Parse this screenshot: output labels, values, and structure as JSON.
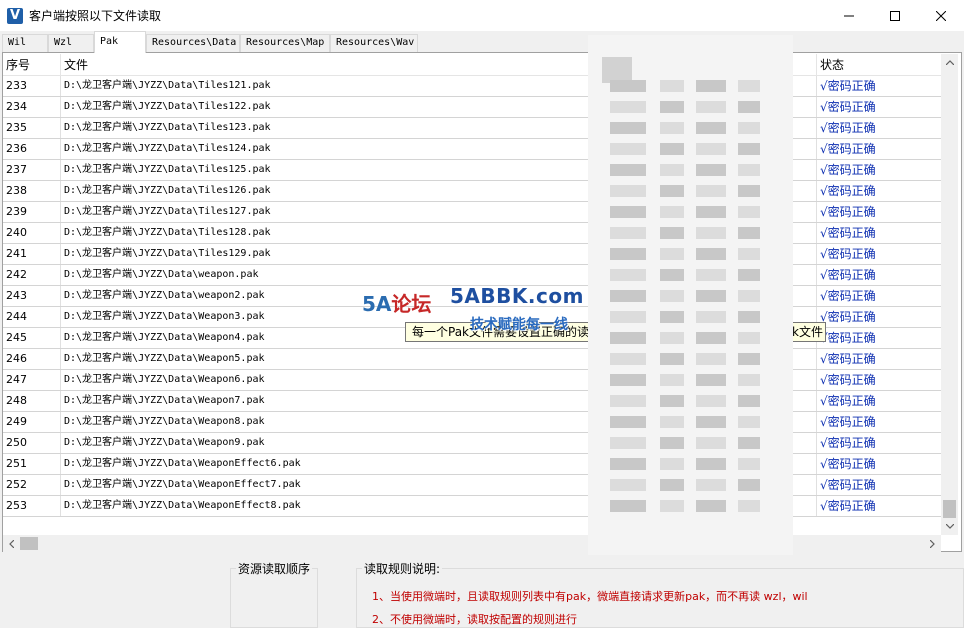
{
  "window": {
    "icon_letter": "V",
    "title": "客户端按照以下文件读取"
  },
  "tabs": [
    {
      "label": "Wil"
    },
    {
      "label": "Wzl"
    },
    {
      "label": "Pak"
    },
    {
      "label": "Resources\\Data"
    },
    {
      "label": "Resources\\Map"
    },
    {
      "label": "Resources\\Wav"
    }
  ],
  "active_tab": "Pak",
  "table": {
    "columns": [
      "序号",
      "文件",
      "状态"
    ],
    "rows": [
      {
        "no": "233",
        "file": "D:\\龙卫客户端\\JYZZ\\Data\\Tiles121.pak",
        "status": "√密码正确"
      },
      {
        "no": "234",
        "file": "D:\\龙卫客户端\\JYZZ\\Data\\Tiles122.pak",
        "status": "√密码正确"
      },
      {
        "no": "235",
        "file": "D:\\龙卫客户端\\JYZZ\\Data\\Tiles123.pak",
        "status": "√密码正确"
      },
      {
        "no": "236",
        "file": "D:\\龙卫客户端\\JYZZ\\Data\\Tiles124.pak",
        "status": "√密码正确"
      },
      {
        "no": "237",
        "file": "D:\\龙卫客户端\\JYZZ\\Data\\Tiles125.pak",
        "status": "√密码正确"
      },
      {
        "no": "238",
        "file": "D:\\龙卫客户端\\JYZZ\\Data\\Tiles126.pak",
        "status": "√密码正确"
      },
      {
        "no": "239",
        "file": "D:\\龙卫客户端\\JYZZ\\Data\\Tiles127.pak",
        "status": "√密码正确"
      },
      {
        "no": "240",
        "file": "D:\\龙卫客户端\\JYZZ\\Data\\Tiles128.pak",
        "status": "√密码正确"
      },
      {
        "no": "241",
        "file": "D:\\龙卫客户端\\JYZZ\\Data\\Tiles129.pak",
        "status": "√密码正确"
      },
      {
        "no": "242",
        "file": "D:\\龙卫客户端\\JYZZ\\Data\\weapon.pak",
        "status": "√密码正确"
      },
      {
        "no": "243",
        "file": "D:\\龙卫客户端\\JYZZ\\Data\\weapon2.pak",
        "status": "√密码正确"
      },
      {
        "no": "244",
        "file": "D:\\龙卫客户端\\JYZZ\\Data\\Weapon3.pak",
        "status": "√密码正确"
      },
      {
        "no": "245",
        "file": "D:\\龙卫客户端\\JYZZ\\Data\\Weapon4.pak",
        "status": "√密码正确"
      },
      {
        "no": "246",
        "file": "D:\\龙卫客户端\\JYZZ\\Data\\Weapon5.pak",
        "status": "√密码正确"
      },
      {
        "no": "247",
        "file": "D:\\龙卫客户端\\JYZZ\\Data\\Weapon6.pak",
        "status": "√密码正确"
      },
      {
        "no": "248",
        "file": "D:\\龙卫客户端\\JYZZ\\Data\\Weapon7.pak",
        "status": "√密码正确"
      },
      {
        "no": "249",
        "file": "D:\\龙卫客户端\\JYZZ\\Data\\Weapon8.pak",
        "status": "√密码正确"
      },
      {
        "no": "250",
        "file": "D:\\龙卫客户端\\JYZZ\\Data\\Weapon9.pak",
        "status": "√密码正确"
      },
      {
        "no": "251",
        "file": "D:\\龙卫客户端\\JYZZ\\Data\\WeaponEffect6.pak",
        "status": "√密码正确"
      },
      {
        "no": "252",
        "file": "D:\\龙卫客户端\\JYZZ\\Data\\WeaponEffect7.pak",
        "status": "√密码正确"
      },
      {
        "no": "253",
        "file": "D:\\龙卫客户端\\JYZZ\\Data\\WeaponEffect8.pak",
        "status": "√密码正确"
      }
    ]
  },
  "tooltip": {
    "text_start": "每一个Pak文件需要设置正确的读",
    "text_end": "k文件"
  },
  "watermark": {
    "logo_prefix": "5A",
    "logo_suffix": "论坛",
    "site": "5ABBK.com",
    "slogan": "技术赋能每一线"
  },
  "bottom": {
    "read_order_label": "资源读取顺序",
    "rules_label": "读取规则说明:",
    "rules": [
      "1、当使用微端时，且读取规则列表中有pak，微端直接请求更新pak，而不再读 wzl，wil",
      "2、不使用微端时，读取按配置的规则进行"
    ]
  },
  "colors": {
    "status_text": "#0b2db0",
    "rule_text": "#c00000",
    "tooltip_bg": "#ffffe1"
  }
}
